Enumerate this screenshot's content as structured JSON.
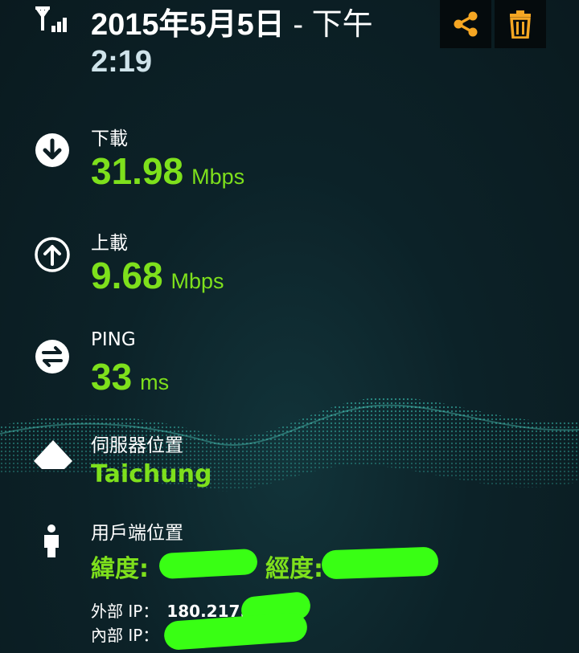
{
  "header": {
    "date": "2015年5月5日",
    "separator": "-",
    "period": "下午",
    "time": "2:19",
    "share_icon": "share-icon",
    "delete_icon": "trash-icon"
  },
  "download": {
    "label": "下載",
    "value": "31.98",
    "unit": "Mbps"
  },
  "upload": {
    "label": "上載",
    "value": "9.68",
    "unit": "Mbps"
  },
  "ping": {
    "label": "PING",
    "value": "33",
    "unit": "ms"
  },
  "server": {
    "label": "伺服器位置",
    "value": "Taichung"
  },
  "client": {
    "label": "用戶端位置",
    "latitude_label": "緯度:",
    "longitude_label": "經度:",
    "external_ip_label": "外部 IP：",
    "external_ip_value": "180.217.",
    "internal_ip_label": "內部 IP："
  },
  "colors": {
    "accent_green": "#7ee01c",
    "toolbar_icon": "#f5a623",
    "background": "#0d1e24"
  }
}
